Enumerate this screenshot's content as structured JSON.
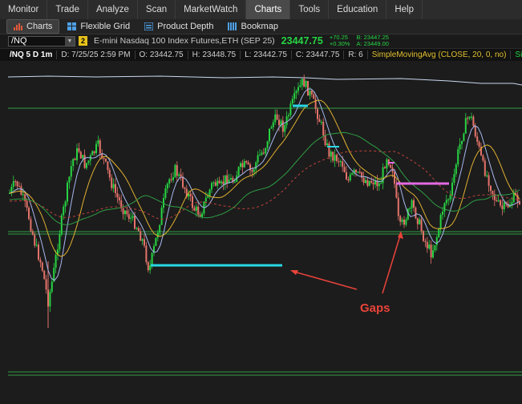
{
  "menubar": {
    "items": [
      "Monitor",
      "Trade",
      "Analyze",
      "Scan",
      "MarketWatch",
      "Charts",
      "Tools",
      "Education",
      "Help"
    ],
    "active": "Charts"
  },
  "toolbar": {
    "charts_label": "Charts",
    "flexible_grid_label": "Flexible Grid",
    "product_depth_label": "Product Depth",
    "bookmap_label": "Bookmap"
  },
  "quote": {
    "symbol": "/NQ",
    "link_badge": "2",
    "description": "E-mini Nasdaq 100 Index Futures,ETH (SEP 25)",
    "last": "23447.75",
    "change": "+70.25",
    "change_pct": "+0.30%",
    "bid": "B: 23447.25",
    "ask": "A: 23449.00"
  },
  "info": {
    "symbol_period": "/NQ 5 D 1m",
    "date": "D: 7/25/25 2:59 PM",
    "open": "O: 23442.75",
    "high": "H: 23448.75",
    "low": "L: 23442.75",
    "close": "C: 23447.75",
    "range": "R: 6",
    "study1": "SimpleMovingAvg (CLOSE, 20, 0, no)",
    "study2": "SimpleMovingAvg"
  },
  "annotation": {
    "label": "Gaps"
  },
  "colors": {
    "up_candle": "#27d342",
    "down_candle": "#e4736a",
    "gap_cyan": "#29d8e6",
    "gap_magenta": "#e26ae2",
    "annotation": "#e8433a",
    "sma_yellow": "#e0b030",
    "sma_blue": "#a7b8ee",
    "sma_green": "#2f9e45"
  }
}
